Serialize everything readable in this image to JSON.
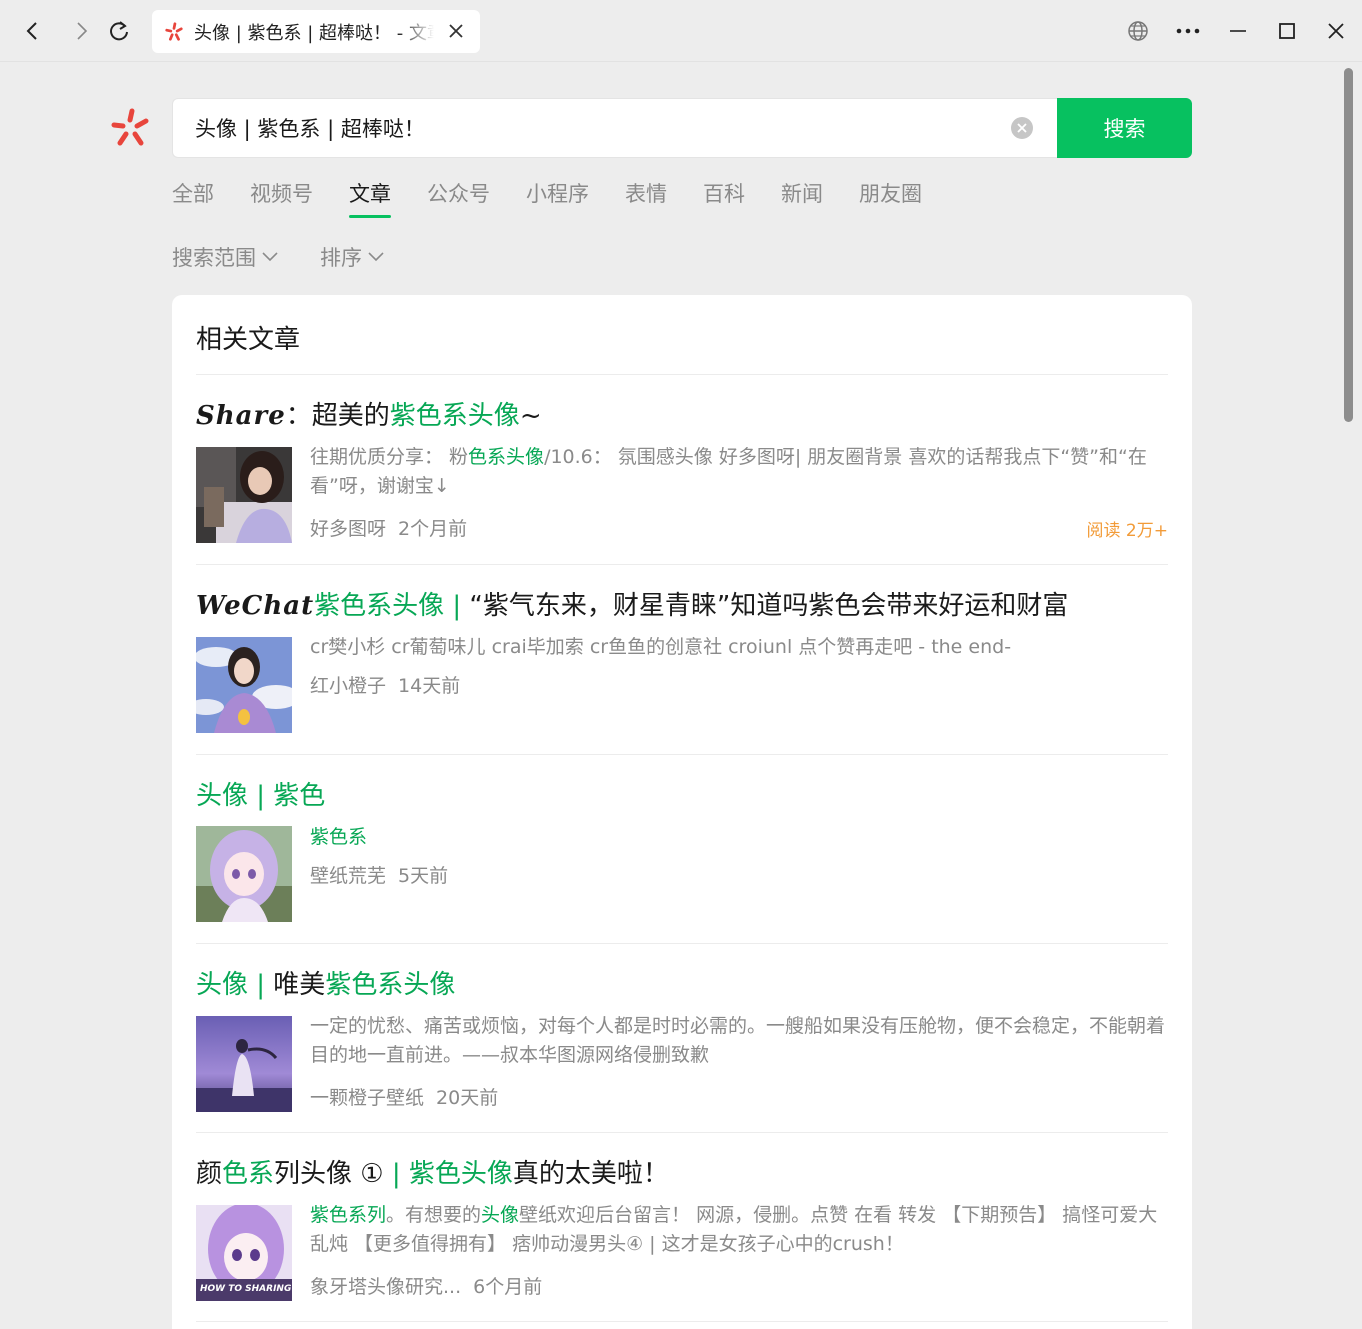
{
  "browser": {
    "tab_title": "头像 | 紫色系 | 超棒哒！ - 文章",
    "icons": [
      "back-icon",
      "forward-icon",
      "refresh-icon",
      "globe-icon",
      "more-icon",
      "minimize-icon",
      "maximize-icon",
      "close-icon"
    ]
  },
  "search": {
    "query": "头像 | 紫色系 | 超棒哒！",
    "button_label": "搜索"
  },
  "tabs": [
    {
      "label": "全部",
      "active": false
    },
    {
      "label": "视频号",
      "active": false
    },
    {
      "label": "文章",
      "active": true
    },
    {
      "label": "公众号",
      "active": false
    },
    {
      "label": "小程序",
      "active": false
    },
    {
      "label": "表情",
      "active": false
    },
    {
      "label": "百科",
      "active": false
    },
    {
      "label": "新闻",
      "active": false
    },
    {
      "label": "朋友圈",
      "active": false
    }
  ],
  "filters": [
    {
      "label": "搜索范围"
    },
    {
      "label": "排序"
    }
  ],
  "section_title": "相关文章",
  "articles": [
    {
      "title_parts": [
        {
          "t": "Share",
          "s": "brand"
        },
        {
          "t": "：超美的",
          "s": ""
        },
        {
          "t": "紫色系头像",
          "s": "g"
        },
        {
          "t": "~",
          "s": ""
        }
      ],
      "desc_parts": [
        {
          "t": "往期优质分享： 粉",
          "s": ""
        },
        {
          "t": "色系头像",
          "s": "g"
        },
        {
          "t": "/10.6： 氛围感头像 好多图呀| 朋友圈背景 喜欢的话帮我点下“赞”和“在看”呀，谢谢宝↓",
          "s": ""
        }
      ],
      "source": "好多图呀",
      "time": "2个月前",
      "read": "阅读 2万+"
    },
    {
      "title_parts": [
        {
          "t": "WeChat",
          "s": "brand"
        },
        {
          "t": "紫色系头像 | ",
          "s": "g"
        },
        {
          "t": "“紫气东来，财星青睐”知道吗紫色会带来好运和财富",
          "s": ""
        }
      ],
      "desc_parts": [
        {
          "t": "cr樊小杉 cr葡萄味儿 crai毕加索 cr鱼鱼的创意社 croiunl 点个赞再走吧 - the end-",
          "s": ""
        }
      ],
      "source": "红小橙子",
      "time": "14天前",
      "read": ""
    },
    {
      "title_parts": [
        {
          "t": "头像 | 紫色",
          "s": "g"
        }
      ],
      "desc_parts": [
        {
          "t": "紫色系",
          "s": "g"
        }
      ],
      "source": "壁纸荒芜",
      "time": "5天前",
      "read": ""
    },
    {
      "title_parts": [
        {
          "t": "头像 | ",
          "s": "g"
        },
        {
          "t": "唯美",
          "s": ""
        },
        {
          "t": "紫色系头像",
          "s": "g"
        }
      ],
      "desc_parts": [
        {
          "t": "一定的忧愁、痛苦或烦恼，对每个人都是时时必需的。一艘船如果没有压舱物，便不会稳定，不能朝着目的地一直前进。——叔本华图源网络侵删致歉",
          "s": ""
        }
      ],
      "source": "一颗橙子壁纸",
      "time": "20天前",
      "read": ""
    },
    {
      "title_parts": [
        {
          "t": "颜",
          "s": ""
        },
        {
          "t": "色系",
          "s": "g"
        },
        {
          "t": "列头像 ① ",
          "s": ""
        },
        {
          "t": "| 紫色头像",
          "s": "g"
        },
        {
          "t": "真的太美啦！",
          "s": ""
        }
      ],
      "desc_parts": [
        {
          "t": "紫色系列",
          "s": "g"
        },
        {
          "t": "。有想要的",
          "s": ""
        },
        {
          "t": "头像",
          "s": "g"
        },
        {
          "t": "壁纸欢迎后台留言！ 网源，侵删。点赞 在看 转发 【下期预告】 搞怪可爱大乱炖 【更多值得拥有】 痞帅动漫男头④ | 这才是女孩子心中的crush！",
          "s": ""
        }
      ],
      "source": "象牙塔头像研究...",
      "time": "6个月前",
      "read": "",
      "thumb_text": "HOW TO SHARING"
    }
  ],
  "colors": {
    "accent": "#07c160",
    "highlight": "#07a755",
    "read_count": "#f29b38",
    "brand_logo": "#e8453c"
  }
}
